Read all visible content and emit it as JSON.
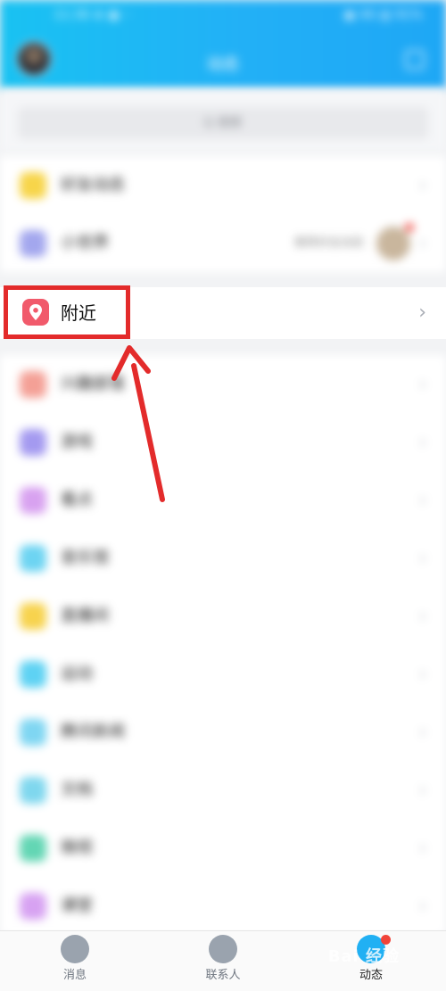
{
  "status_bar": {
    "left": "11:36 ⊕ ▣ ··",
    "right": "▣ 46 ▥ 91%"
  },
  "header": {
    "title": "动态"
  },
  "search": {
    "placeholder": "Q 搜索"
  },
  "group1": {
    "items": [
      {
        "label": "好友动态",
        "icon_color": "#f7d54a"
      },
      {
        "label": "小世界",
        "icon_color": "#a3a7ee",
        "aside_text": "推荐好友动态"
      }
    ]
  },
  "nearby": {
    "label": "附近",
    "icon": "location-pin-icon",
    "icon_color": "#f15a6b"
  },
  "group2": {
    "items": [
      {
        "label": "兴趣部落",
        "icon_color": "#f4a096"
      },
      {
        "label": "游戏",
        "icon_color": "#a49af0"
      },
      {
        "label": "看点",
        "icon_color": "#d8a2f0"
      },
      {
        "label": "音乐馆",
        "icon_color": "#6dd4f2"
      },
      {
        "label": "直播间",
        "icon_color": "#f7d34e"
      },
      {
        "label": "运动",
        "icon_color": "#5ed2f3"
      },
      {
        "label": "腾讯新闻",
        "icon_color": "#7fd6f2"
      },
      {
        "label": "文档",
        "icon_color": "#7fd7ee"
      },
      {
        "label": "微视",
        "icon_color": "#63d6b4"
      },
      {
        "label": "课堂",
        "icon_color": "#d7a2f2"
      }
    ]
  },
  "bottom_nav": {
    "items": [
      {
        "label": "消息",
        "icon": "message-icon"
      },
      {
        "label": "联系人",
        "icon": "contacts-icon"
      },
      {
        "label": "动态",
        "icon": "moments-icon",
        "active": true
      }
    ]
  },
  "watermark": "Bai 经验",
  "colors": {
    "highlight": "#e32b2b",
    "header": "#1fb3f4"
  }
}
